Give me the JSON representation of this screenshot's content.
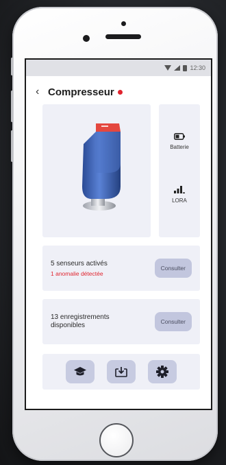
{
  "status_bar": {
    "time": "12:30"
  },
  "header": {
    "back_label": "‹",
    "title": "Compresseur",
    "status_color": "#e0242e"
  },
  "device": {
    "image_icon": "pressure-sensor-device",
    "body_color": "#3f63b5",
    "cap_color": "#e4473f"
  },
  "stats": {
    "battery": {
      "icon": "battery-icon",
      "label": "Batterie"
    },
    "signal": {
      "icon": "signal-bars-icon",
      "label": "LORA"
    }
  },
  "sensors": {
    "text": "5 senseurs activés",
    "alert": "1 anomalie détectée",
    "button": "Consulter"
  },
  "records": {
    "text": "13 enregistrements disponibles",
    "button": "Consulter"
  },
  "toolbar": {
    "items": [
      {
        "icon": "graduation-cap-icon"
      },
      {
        "icon": "download-icon"
      },
      {
        "icon": "gear-icon"
      }
    ]
  },
  "colors": {
    "accent": "#c7cbe1",
    "card_bg": "#eff0f7",
    "alert": "#e0242e"
  }
}
